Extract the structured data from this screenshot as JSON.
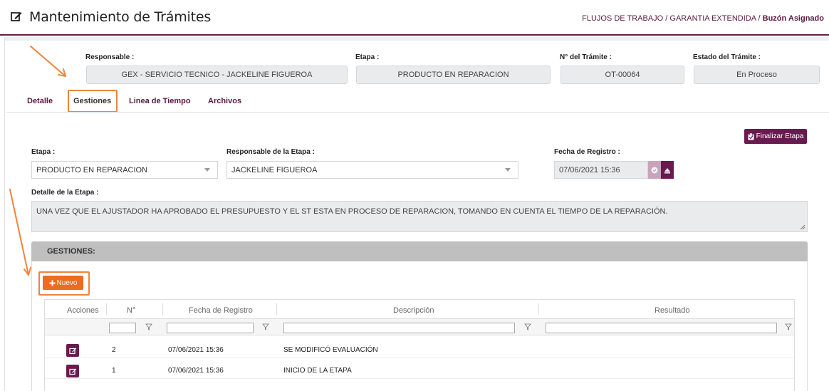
{
  "header": {
    "title": "Mantenimiento de Trámites",
    "breadcrumb": [
      "FLUJOS DE TRABAJO",
      "GARANTIA EXTENDIDA",
      "Buzón Asignado"
    ],
    "separator": "/"
  },
  "summary": {
    "responsable_label": "Responsable :",
    "responsable_value": "GEX - SERVICIO TECNICO - JACKELINE FIGUEROA",
    "etapa_label": "Etapa :",
    "etapa_value": "PRODUCTO EN REPARACION",
    "numero_label": "N° del Trámite :",
    "numero_value": "OT-00064",
    "estado_label": "Estado del Trámite :",
    "estado_value": "En Proceso"
  },
  "tabs": [
    {
      "label": "Detalle",
      "active": false
    },
    {
      "label": "Gestiones",
      "active": true
    },
    {
      "label": "Linea de Tiempo",
      "active": false
    },
    {
      "label": "Archivos",
      "active": false
    }
  ],
  "form": {
    "finalizar_label": "Finalizar Etapa",
    "etapa_label": "Etapa :",
    "etapa_value": "PRODUCTO EN REPARACION",
    "responsable_label": "Responsable de la Etapa :",
    "responsable_value": "JACKELINE FIGUEROA",
    "fecha_label": "Fecha de Registro :",
    "fecha_value": "07/06/2021 15:36",
    "detalle_label": "Detalle de la Etapa :",
    "detalle_value": "UNA VEZ QUE EL AJUSTADOR HA APROBADO EL PRESUPUESTO Y EL ST ESTA EN PROCESO DE REPARACION, TOMANDO EN CUENTA EL TIEMPO DE LA REPARACIÓN."
  },
  "gestiones": {
    "title": "GESTIONES:",
    "nuevo_label": "Nuevo",
    "columns": [
      "Acciones",
      "N°",
      "Fecha de Registro",
      "Descripción",
      "Resultado"
    ],
    "rows": [
      {
        "n": "2",
        "fecha": "07/06/2021 15:36",
        "descripcion": "SE MODIFICÓ EVALUACIÓN",
        "resultado": ""
      },
      {
        "n": "1",
        "fecha": "07/06/2021 15:36",
        "descripcion": "INICIO DE LA ETAPA",
        "resultado": ""
      }
    ]
  },
  "colors": {
    "primary": "#6b1a4f",
    "accent": "#ef6b1f",
    "highlight": "#f0843c",
    "panel_header": "#bfbfbf"
  },
  "icons": [
    "edit-icon",
    "clipboard-icon",
    "chevron-down-icon",
    "calendar-check-icon",
    "eraser-icon",
    "plus-icon",
    "filter-icon",
    "edit-row-icon"
  ]
}
